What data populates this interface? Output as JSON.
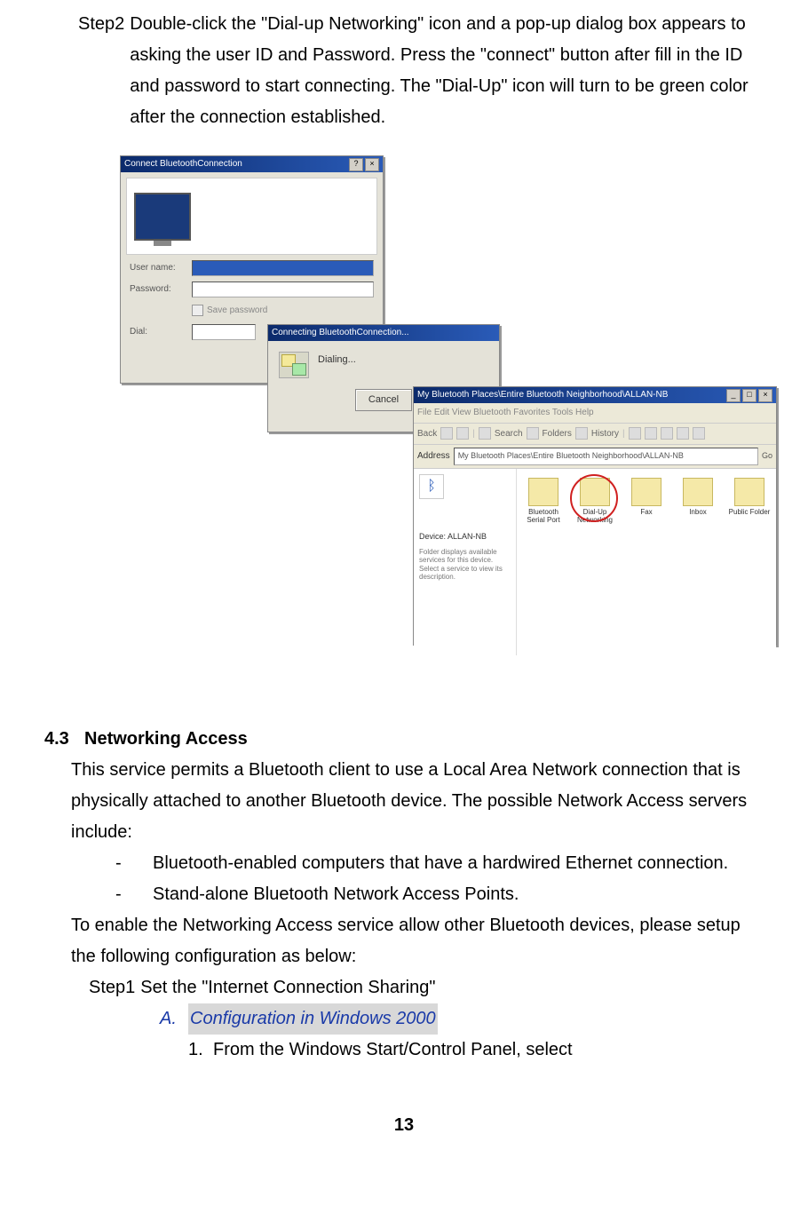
{
  "step2": {
    "label": "Step2",
    "body": "Double-click the \"Dial-up Networking\" icon and a pop-up dialog box appears to asking the user ID and Password. Press the \"connect\" button after fill in the ID and password to start connecting. The \"Dial-Up\" icon will turn to be green color after the connection established."
  },
  "win1": {
    "title": "Connect BluetoothConnection",
    "username_label": "User name:",
    "password_label": "Password:",
    "save_pw": "Save password",
    "dial_label": "Dial:"
  },
  "win2": {
    "title": "Connecting BluetoothConnection...",
    "status": "Dialing...",
    "cancel": "Cancel"
  },
  "win3": {
    "title": "My Bluetooth Places\\Entire Bluetooth Neighborhood\\ALLAN-NB",
    "menu": "File  Edit  View  Bluetooth  Favorites  Tools  Help",
    "toolbar_back": "Back",
    "toolbar_search": "Search",
    "toolbar_folders": "Folders",
    "toolbar_history": "History",
    "address_label": "Address",
    "address_value": "My Bluetooth Places\\Entire Bluetooth Neighborhood\\ALLAN-NB",
    "go": "Go",
    "sidebar_device": "Device: ALLAN-NB",
    "sidebar_desc": "Folder displays available services for this device. Select a service to view its description.",
    "icons": {
      "i1": "Bluetooth Serial Port",
      "i2": "Dial-Up Networking",
      "i3": "Fax",
      "i4": "Inbox",
      "i5": "Public Folder"
    }
  },
  "section": {
    "num": "4.3",
    "title": "Networking Access",
    "p1": "This service permits a Bluetooth client to use a Local Area Network connection that is physically attached to another Bluetooth device. The possible Network Access servers include:",
    "b1": "Bluetooth-enabled computers that have a hardwired Ethernet connection.",
    "b2": "Stand-alone Bluetooth Network Access Points.",
    "p2": "To enable the Networking Access service allow other Bluetooth devices, please setup the following configuration as below:",
    "step1_label": "Step1",
    "step1_text": "Set the \"Internet Connection Sharing\"",
    "a_label": "A.",
    "a_text": "Configuration in Windows 2000",
    "n1_label": "1.",
    "n1_text": "From the Windows Start/Control Panel, select"
  },
  "page_number": "13"
}
